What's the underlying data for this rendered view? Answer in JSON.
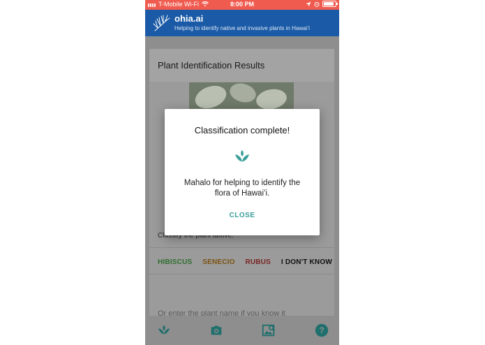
{
  "status_bar": {
    "carrier": "T-Mobile Wi-Fi",
    "time": "8:00 PM",
    "icons": [
      "signal-icon",
      "wifi-icon",
      "location-icon",
      "alarm-icon",
      "battery-icon"
    ],
    "battery_level": 0.9
  },
  "app_bar": {
    "title": "ohia.ai",
    "subtitle": "Helping to identify native and invasive plants in Hawaiʻi",
    "background": "#1a5aa6"
  },
  "results_card": {
    "title": "Plant Identification Results",
    "classify_prompt": "Classify the plant above:",
    "choices": [
      {
        "label": "HIBISCUS",
        "color": "#2e6e2e"
      },
      {
        "label": "SENECIO",
        "color": "#7a5210"
      },
      {
        "label": "RUBUS",
        "color": "#7a2323"
      },
      {
        "label": "I DON'T KNOW",
        "color": "#111111"
      }
    ],
    "input_placeholder": "Or enter the plant name if you know it"
  },
  "dialog": {
    "title": "Classification complete!",
    "icon": "sprout-icon",
    "message": "Mahalo for helping to identify the flora of Hawaiʻi.",
    "close_label": "CLOSE",
    "accent": "#3a9e9a"
  },
  "bottom_nav": {
    "items": [
      "sprout-icon",
      "camera-icon",
      "gallery-search-icon",
      "help-icon"
    ],
    "accent": "#1f6f6c"
  }
}
